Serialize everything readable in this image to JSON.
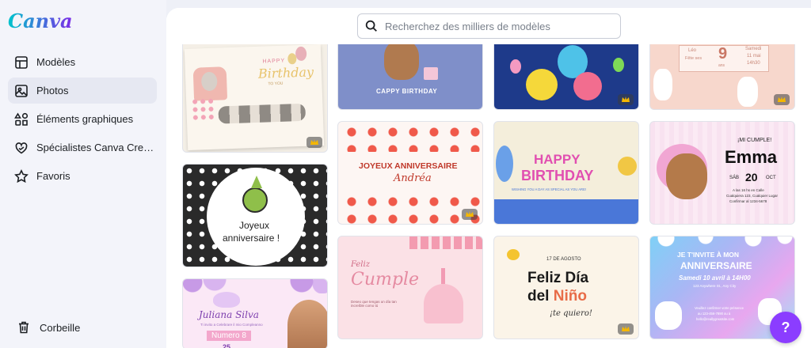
{
  "app": {
    "logo": "Canva"
  },
  "sidebar": {
    "items": [
      {
        "label": "Modèles",
        "icon": "template-icon"
      },
      {
        "label": "Photos",
        "icon": "photo-icon",
        "active": true
      },
      {
        "label": "Éléments graphiques",
        "icon": "shapes-icon"
      },
      {
        "label": "Spécialistes Canva Crea...",
        "icon": "heart-hand-icon"
      },
      {
        "label": "Favoris",
        "icon": "star-icon"
      }
    ],
    "trash_label": "Corbeille"
  },
  "search": {
    "placeholder": "Recherchez des milliers de modèles"
  },
  "cards": {
    "c1": {
      "line1": "HAPPY",
      "line2": "Birthday",
      "line3": "TO YOU"
    },
    "c2": {
      "text": "CAPPY BIRTHDAY"
    },
    "c4": {
      "name": "Léo",
      "sub": "Fête ses",
      "age": "9",
      "ans": "ans",
      "day": "Samedi",
      "date": "11 mai",
      "time": "14h30"
    },
    "c5": {
      "line1": "Joyeux",
      "line2": "anniversaire !"
    },
    "c6": {
      "title": "JOYEUX ANNIVERSAIRE",
      "name": "Andréa"
    },
    "c7": {
      "line1": "HAPPY",
      "line2": "BIRTHDAY",
      "sub": "WISHING YOU A DAY AS SPECIAL AS YOU ARE!"
    },
    "c8": {
      "top": "¡MI CUMPLE!",
      "name": "Emma",
      "day": "SÁB",
      "num": "20",
      "month": "OCT",
      "l1": "A las 16 hs en Calle",
      "l2": "Cualquiera 123, Cualquier Lugar",
      "l3": "Confirmar al 1234-5678"
    },
    "c9": {
      "name": "Juliana Silva",
      "sub": "Ti invito a Celebrare il mio Compleanno",
      "num": "Numero 8",
      "date": "25"
    },
    "c10": {
      "line1": "Feliz",
      "line2": "Cumple",
      "sub": "Deseo que tengas un día tan increíble como tú"
    },
    "c11": {
      "date": "17 DE AGOSTO",
      "line1": "Feliz Día",
      "line2a": "del ",
      "line2b": "Niño",
      "line3": "¡te quiero!"
    },
    "c12": {
      "line1": "JE T'INVITE À MON",
      "line2": "ANNIVERSAIRE",
      "line3": "Samedi 10 avril à 14H00",
      "line4": "123 Anywhere St., Any City",
      "line5": "Veuillez confirmer votre présence",
      "line6": "au 123-456-7890 ou à",
      "line7": "hello@reallygreatsite.com"
    }
  },
  "help": {
    "label": "?"
  },
  "colors": {
    "accent": "#8b3dff",
    "sidebar_bg": "#f3f4fa",
    "active_bg": "#e6e8f2"
  }
}
